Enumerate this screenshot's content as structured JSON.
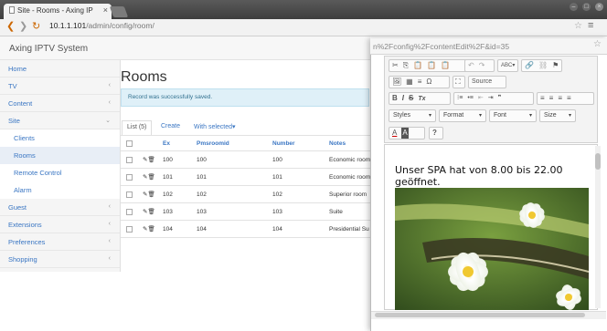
{
  "browser": {
    "tab_title": "Site - Rooms - Axing IP",
    "url_host": "10.1.1.101",
    "url_path": "/admin/config/room/",
    "win_min": "–",
    "win_max": "□",
    "win_close": "×"
  },
  "app": {
    "title": "Axing IPTV System"
  },
  "sidebar": {
    "items": [
      {
        "label": "Home",
        "chevron": ""
      },
      {
        "label": "TV",
        "chevron": "‹"
      },
      {
        "label": "Content",
        "chevron": "‹"
      },
      {
        "label": "Site",
        "chevron": "⌄"
      },
      {
        "label": "Clients",
        "chevron": ""
      },
      {
        "label": "Rooms",
        "chevron": ""
      },
      {
        "label": "Remote Control",
        "chevron": ""
      },
      {
        "label": "Alarm",
        "chevron": ""
      },
      {
        "label": "Guest",
        "chevron": "‹"
      },
      {
        "label": "Extensions",
        "chevron": "‹"
      },
      {
        "label": "Preferences",
        "chevron": "‹"
      },
      {
        "label": "Shopping",
        "chevron": "‹"
      }
    ]
  },
  "main": {
    "page_title": "Rooms",
    "alert": "Record was successfully saved.",
    "tabs": {
      "list": "List (5)",
      "create": "Create",
      "with_selected": "With selected▾"
    },
    "columns": [
      "Ex",
      "Pmsroomid",
      "Number",
      "Notes"
    ],
    "rows": [
      {
        "ex": "100",
        "pms": "100",
        "number": "100",
        "notes": "Economic room"
      },
      {
        "ex": "101",
        "pms": "101",
        "number": "101",
        "notes": "Economic room"
      },
      {
        "ex": "102",
        "pms": "102",
        "number": "102",
        "notes": "Superior room"
      },
      {
        "ex": "103",
        "pms": "103",
        "number": "103",
        "notes": "Suite"
      },
      {
        "ex": "104",
        "pms": "104",
        "number": "104",
        "notes": "Presidential Su"
      }
    ],
    "row_actions": "✎🗑"
  },
  "popup": {
    "url": "n%2Fconfig%2FcontentEdit%2F&id=35",
    "toolbar": {
      "row1_a": [
        "✂",
        "⎘",
        "📋",
        "📋",
        "📋"
      ],
      "undo": "↶",
      "redo": "↷",
      "spell": "ABC▾",
      "link": "🔗",
      "unlink": "⛓",
      "flag": "⚑",
      "row2_a": [
        "🖼",
        "▦",
        "≡",
        "Ω"
      ],
      "maximize": "⛶",
      "source": "Source",
      "bold": "B",
      "italic": "I",
      "strike": "S",
      "clear": "Tx",
      "lists": [
        "⁝≡",
        "•≡",
        "⇤",
        "⇥",
        "❞"
      ],
      "align": [
        "≡",
        "≡",
        "≡",
        "≡"
      ],
      "styles": "Styles",
      "format": "Format",
      "font": "Font",
      "size": "Size",
      "textcolor": "A",
      "bgcolor": "A",
      "help": "?"
    },
    "content_text": "Unser SPA hat von 8.00 bis 22.00 geöffnet."
  }
}
